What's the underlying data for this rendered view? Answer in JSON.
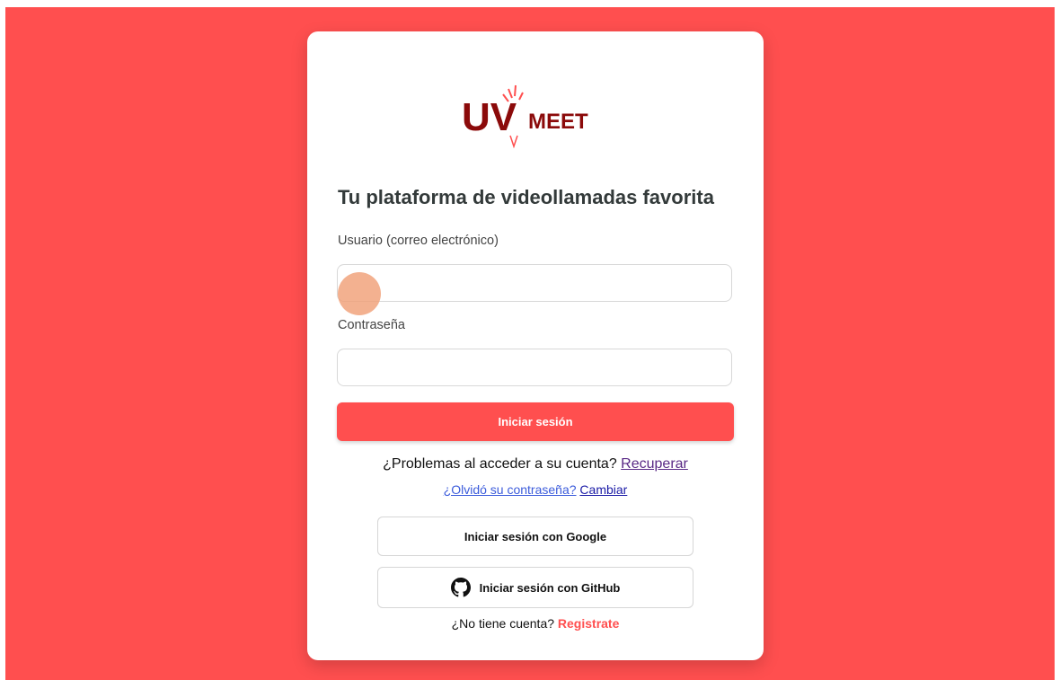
{
  "brand": {
    "logo_letters": "UV",
    "logo_word": "MEET",
    "logo_color": "#8b0a0a",
    "accent": "#ff4f4f"
  },
  "login": {
    "headline": "Tu plataforma de videollamadas favorita",
    "user_label": "Usuario (correo electrónico)",
    "user_value": "",
    "password_label": "Contraseña",
    "password_value": "",
    "submit_label": "Iniciar sesión",
    "problems_text": "¿Problemas al acceder a su cuenta?",
    "recover_link": "Recuperar",
    "forgot_text": "¿Olvidó su contraseña?",
    "change_link": "Cambiar",
    "google_label": "Iniciar sesión con Google",
    "github_label": "Iniciar sesión con GitHub",
    "github_icon": "github-icon",
    "no_account_text": "¿No tiene cuenta?",
    "register_link": "Registrate"
  }
}
